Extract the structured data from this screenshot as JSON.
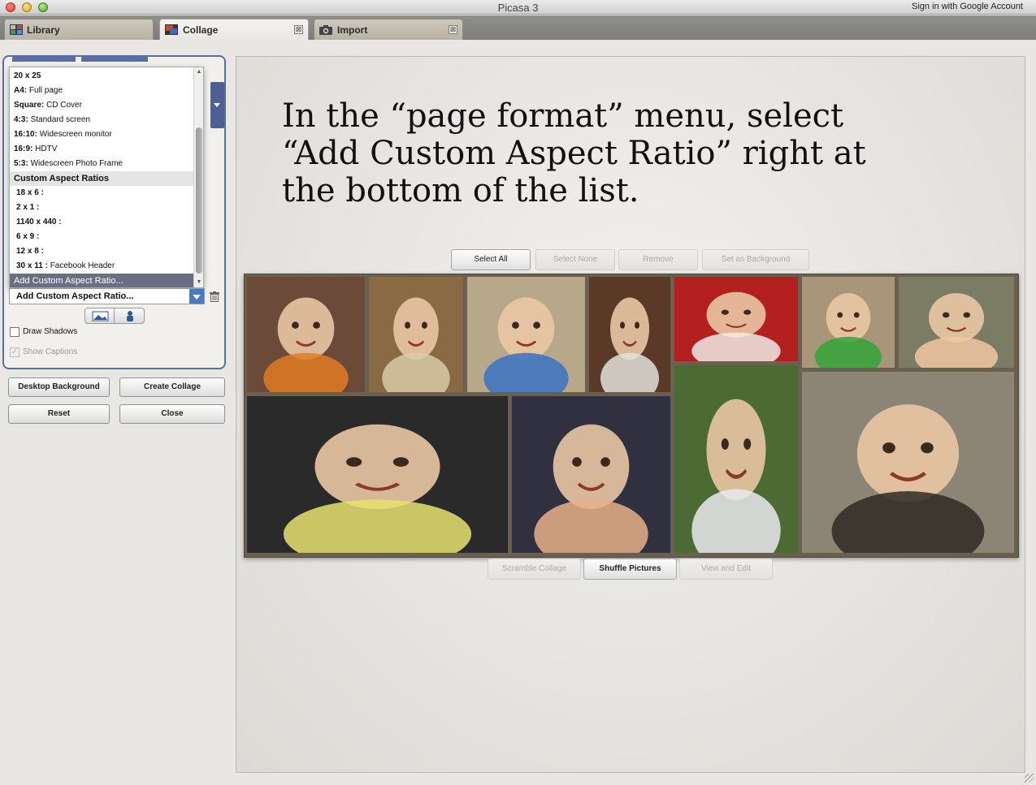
{
  "window": {
    "title": "Picasa 3",
    "signin_label": "Sign in with Google Account"
  },
  "tabs": [
    {
      "label": "Library",
      "icon": "library-icon",
      "active": false
    },
    {
      "label": "Collage",
      "icon": "collage-icon",
      "active": true,
      "close": "⊠"
    },
    {
      "label": "Import",
      "icon": "camera-icon",
      "active": false,
      "close": "⊠"
    }
  ],
  "page_format": {
    "options": [
      {
        "label": "20 x 25",
        "desc": ""
      },
      {
        "label": "A4:",
        "desc": "Full page"
      },
      {
        "label": "Square:",
        "desc": "CD Cover"
      },
      {
        "label": "4:3:",
        "desc": "Standard screen"
      },
      {
        "label": "16:10:",
        "desc": "Widescreen monitor"
      },
      {
        "label": "16:9:",
        "desc": "HDTV"
      },
      {
        "label": "5:3:",
        "desc": "Widescreen Photo Frame"
      }
    ],
    "custom_header": "Custom Aspect Ratios",
    "custom_options": [
      {
        "label": "18 x 6 :",
        "desc": ""
      },
      {
        "label": "2 x 1 :",
        "desc": ""
      },
      {
        "label": "1140 x 440 :",
        "desc": ""
      },
      {
        "label": "6 x 9 :",
        "desc": ""
      },
      {
        "label": "12 x 8 :",
        "desc": ""
      },
      {
        "label": "30 x 11 :",
        "desc": "Facebook Header"
      }
    ],
    "highlighted_option": "Add Custom Aspect Ratio...",
    "selected_value": "Add Custom Aspect Ratio..."
  },
  "options": {
    "draw_shadows": {
      "label": "Draw Shadows",
      "checked": false
    },
    "show_captions": {
      "label": "Show Captions",
      "checked": true,
      "check_glyph": "✓",
      "enabled": false
    }
  },
  "buttons": {
    "desktop_background": "Desktop Background",
    "create_collage": "Create Collage",
    "reset": "Reset",
    "close": "Close"
  },
  "instruction": "In the “page format” menu, select “Add Custom Aspect Ratio” right at the bottom of the list.",
  "toolbar": {
    "select_all": "Select All",
    "select_none": "Select None",
    "remove": "Remove",
    "set_background": "Set as Background"
  },
  "bottom_toolbar": {
    "scramble": "Scramble Collage",
    "shuffle": "Shuffle Pictures",
    "view_edit": "View and Edit"
  },
  "collage": {
    "photos": [
      {
        "name": "photo-tiger-face-child",
        "bg": "#6b4a3a",
        "accent": "#e07a25"
      },
      {
        "name": "photo-baby-on-wood",
        "bg": "#8a6a42",
        "accent": "#d8c9a6"
      },
      {
        "name": "photo-baby-with-balls",
        "bg": "#b8a88a",
        "accent": "#3a72c2"
      },
      {
        "name": "photo-toddler-eating",
        "bg": "#5a3a26",
        "accent": "#e2e0dc"
      },
      {
        "name": "photo-newborn-red",
        "bg": "#b42020",
        "accent": "#f0eae4"
      },
      {
        "name": "photo-baby-with-green-toy",
        "bg": "#a99578",
        "accent": "#33a43a"
      },
      {
        "name": "photo-smiling-boy",
        "bg": "#7a7c64",
        "accent": "#f2c7a2"
      },
      {
        "name": "photo-doll-and-baby",
        "bg": "#2a2a2a",
        "accent": "#e8e270"
      },
      {
        "name": "photo-boy-with-dog",
        "bg": "#4c6a34",
        "accent": "#e9e9f0"
      },
      {
        "name": "photo-bath-toddler",
        "bg": "#303040",
        "accent": "#e6b088"
      },
      {
        "name": "photo-boy-portrait-sepia",
        "bg": "#8c8474",
        "accent": "#2e2a24"
      }
    ]
  }
}
